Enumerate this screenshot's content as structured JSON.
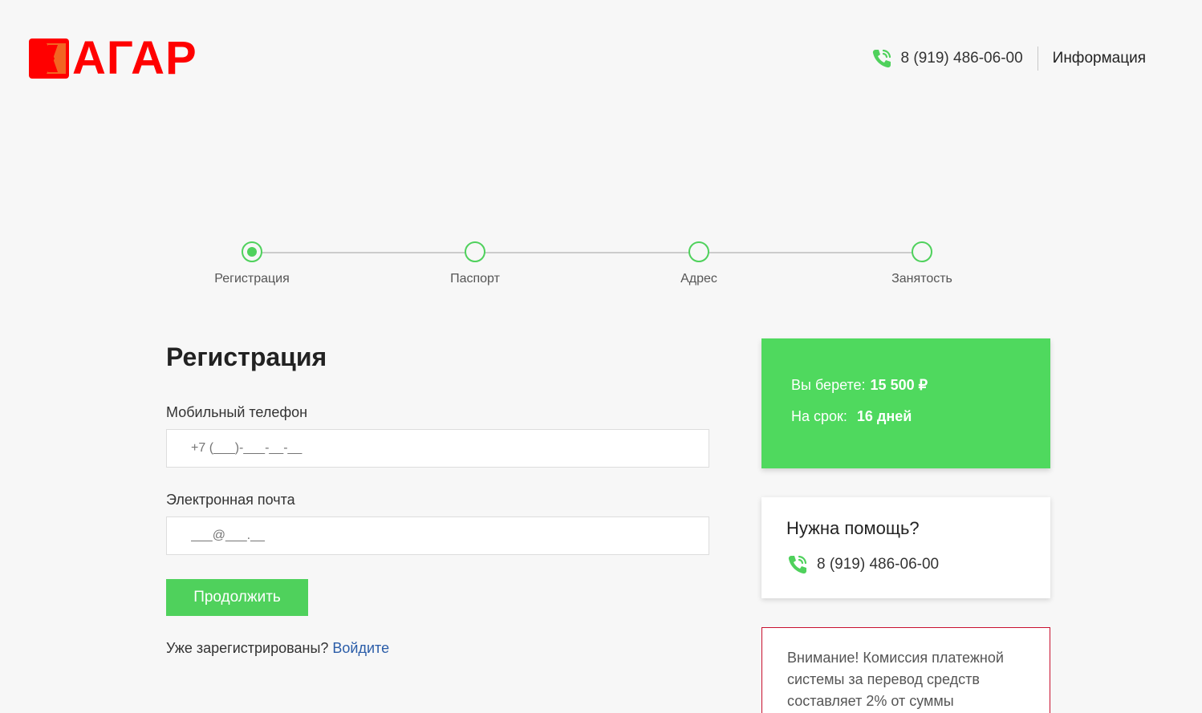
{
  "header": {
    "logo_text": "АГАР",
    "phone": "8 (919) 486-06-00",
    "info_link": "Информация"
  },
  "steps": [
    {
      "label": "Регистрация",
      "state": "active"
    },
    {
      "label": "Паспорт",
      "state": "pending"
    },
    {
      "label": "Адрес",
      "state": "pending"
    },
    {
      "label": "Занятость",
      "state": "pending"
    }
  ],
  "form": {
    "title": "Регистрация",
    "phone_label": "Мобильный телефон",
    "phone_placeholder": "+7 (___)-___-__-__",
    "email_label": "Электронная почта",
    "email_placeholder": "___@___.__",
    "submit_label": "Продолжить",
    "login_prompt": "Уже зарегистрированы?",
    "login_link": "Войдите"
  },
  "summary": {
    "amount_label": "Вы берете:",
    "amount_value": "15 500 ₽",
    "term_label": "На срок:",
    "term_value": "16 дней"
  },
  "help": {
    "title": "Нужна помощь?",
    "phone": "8 (919) 486-06-00"
  },
  "warning": {
    "text": "Внимание! Комиссия платежной системы за перевод средств составляет 2% от суммы"
  },
  "colors": {
    "accent_green": "#4fd15c",
    "brand_red": "#ff0000",
    "link_blue": "#2a5ca8",
    "warning_border": "#c8102e"
  }
}
